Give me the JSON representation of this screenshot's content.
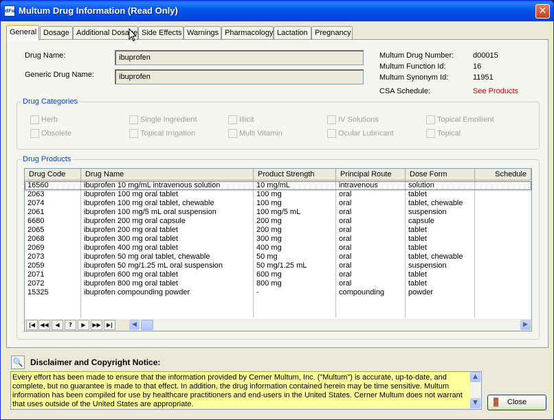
{
  "window": {
    "icon_text": "dFu",
    "title": "Multum Drug Information (Read Only)",
    "close_glyph": "✕"
  },
  "tabs": [
    {
      "label": "General",
      "active": true
    },
    {
      "label": "Dosage"
    },
    {
      "label": "Additional Dosage"
    },
    {
      "label": "Side Effects"
    },
    {
      "label": "Warnings"
    },
    {
      "label": "Pharmacology"
    },
    {
      "label": "Lactation"
    },
    {
      "label": "Pregnancy"
    }
  ],
  "general": {
    "drug_name_label": "Drug Name:",
    "drug_name": "ibuprofen",
    "generic_name_label": "Generic Drug Name:",
    "generic_name": "ibuprofen",
    "multum_number_label": "Multum Drug Number:",
    "multum_number": "d00015",
    "function_id_label": "Multum Function Id:",
    "function_id": "16",
    "synonym_id_label": "Multum Synonym Id:",
    "synonym_id": "11951",
    "csa_label": "CSA Schedule:",
    "csa_value": "See Products",
    "csa_color": "#cc0000"
  },
  "categories": {
    "legend": "Drug Categories",
    "items": [
      {
        "label": "Herb",
        "checked": false
      },
      {
        "label": "Single Ingredient",
        "checked": false
      },
      {
        "label": "Illicit",
        "checked": false
      },
      {
        "label": "IV Solutions",
        "checked": false
      },
      {
        "label": "Topical Emollient",
        "checked": false
      },
      {
        "label": "Obsolete",
        "checked": false
      },
      {
        "label": "Topical Irrigation",
        "checked": false
      },
      {
        "label": "Multi Vitamin",
        "checked": false
      },
      {
        "label": "Ocular Lubricant",
        "checked": false
      },
      {
        "label": "Topical",
        "checked": false
      }
    ]
  },
  "products": {
    "legend": "Drug Products",
    "columns": [
      "Drug Code",
      "Drug Name",
      "Product Strength",
      "Principal Route",
      "Dose Form",
      "Schedule"
    ],
    "rows": [
      [
        "16560",
        "ibuprofen 10 mg/mL intravenous solution",
        "10 mg/mL",
        "intravenous",
        "solution",
        ""
      ],
      [
        "2063",
        "ibuprofen 100 mg oral tablet",
        "100 mg",
        "oral",
        "tablet",
        ""
      ],
      [
        "2074",
        "ibuprofen 100 mg oral tablet, chewable",
        "100 mg",
        "oral",
        "tablet, chewable",
        ""
      ],
      [
        "2061",
        "ibuprofen 100 mg/5 mL oral suspension",
        "100 mg/5 mL",
        "oral",
        "suspension",
        ""
      ],
      [
        "6680",
        "ibuprofen 200 mg oral capsule",
        "200 mg",
        "oral",
        "capsule",
        ""
      ],
      [
        "2065",
        "ibuprofen 200 mg oral tablet",
        "200 mg",
        "oral",
        "tablet",
        ""
      ],
      [
        "2068",
        "ibuprofen 300 mg oral tablet",
        "300 mg",
        "oral",
        "tablet",
        ""
      ],
      [
        "2069",
        "ibuprofen 400 mg oral tablet",
        "400 mg",
        "oral",
        "tablet",
        ""
      ],
      [
        "2073",
        "ibuprofen 50 mg oral tablet, chewable",
        "50 mg",
        "oral",
        "tablet, chewable",
        ""
      ],
      [
        "2059",
        "ibuprofen 50 mg/1.25 mL oral suspension",
        "50 mg/1.25 mL",
        "oral",
        "suspension",
        ""
      ],
      [
        "2071",
        "ibuprofen 600 mg oral tablet",
        "600 mg",
        "oral",
        "tablet",
        ""
      ],
      [
        "2072",
        "ibuprofen 800 mg oral tablet",
        "800 mg",
        "oral",
        "tablet",
        ""
      ],
      [
        "15325",
        "ibuprofen compounding powder",
        "-",
        "compounding",
        "powder",
        ""
      ]
    ],
    "nav": [
      "|◀",
      "◀◀",
      "◀",
      "?",
      "▶",
      "▶▶",
      "▶|"
    ]
  },
  "disclaimer": {
    "title": "Disclaimer and Copyright Notice:",
    "text": "Every effort has been made to ensure that the information provided by Cerner Multum, Inc. (\"Multum\") is accurate, up-to-date, and complete, but no guarantee is made to that effect. In addition, the drug information contained herein may be time sensitive. Multum information has been compiled for use by healthcare practitioners and end-users in the United States. Cerner Multum does not warrant that uses outside of the United States are appropriate."
  },
  "close_button": {
    "label": "Close"
  }
}
